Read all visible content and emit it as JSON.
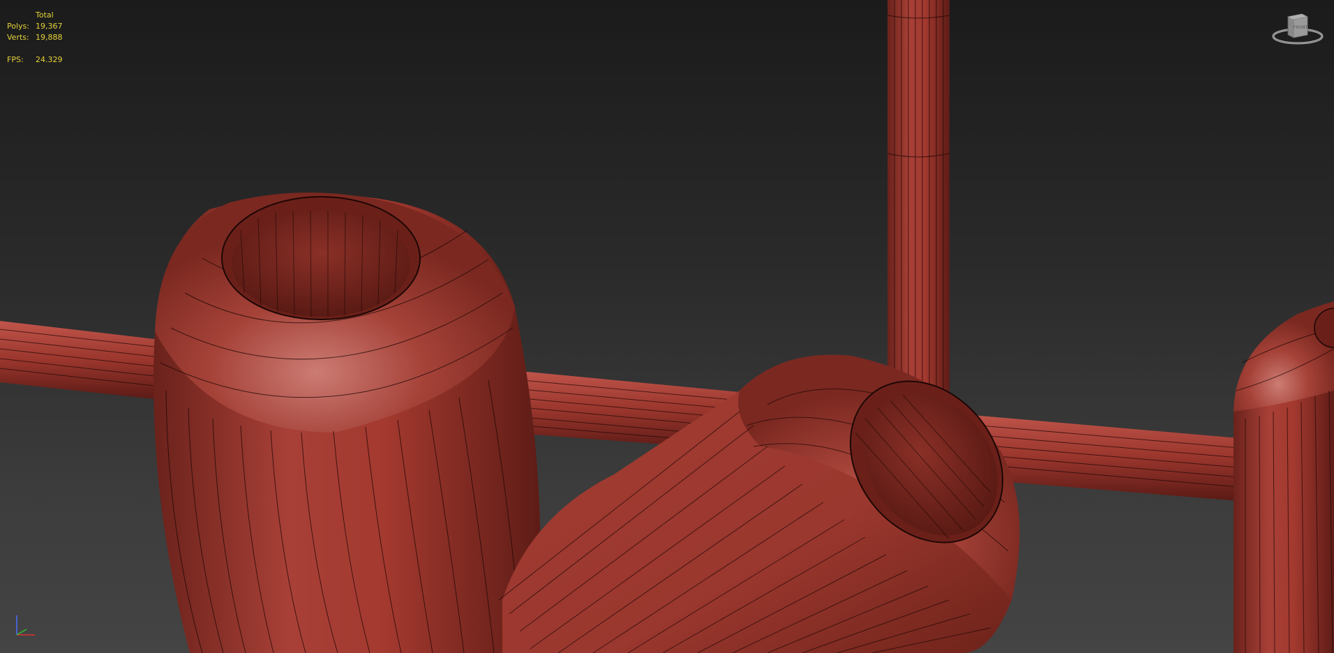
{
  "stats": {
    "header": "Total",
    "polys_label": "Polys:",
    "polys_value": "19,367",
    "verts_label": "Verts:",
    "verts_value": "19,888",
    "fps_label": "FPS:",
    "fps_value": "24.329"
  },
  "viewcube": {
    "face_label": "FRONT"
  },
  "colors": {
    "stats_text": "#e6d23a",
    "mesh_base": "#9c3a30",
    "mesh_shadow": "#5a1b16",
    "mesh_highlight": "#c8706a",
    "wire": "#1c0604",
    "bg_top": "#1b1b1b",
    "bg_bottom": "#444444"
  }
}
